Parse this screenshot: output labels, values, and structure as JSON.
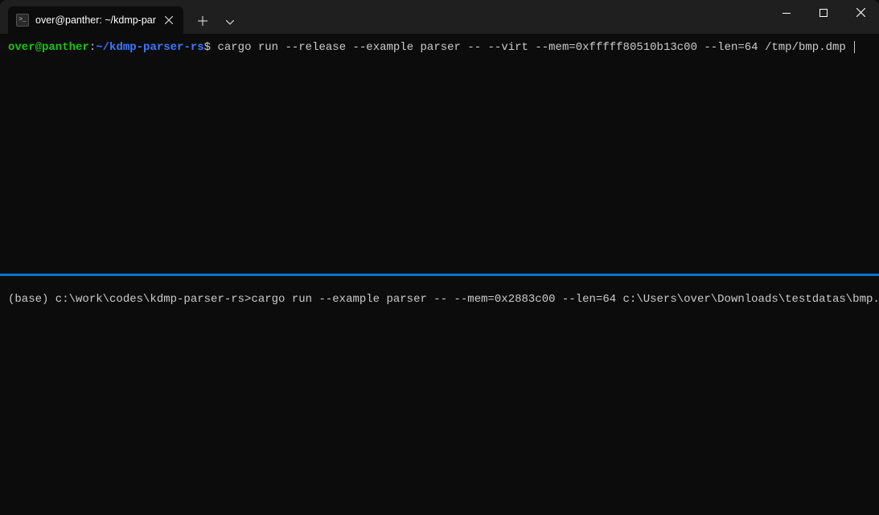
{
  "window": {
    "tab_title": "over@panther: ~/kdmp-parse"
  },
  "pane_top": {
    "prompt_user": "over@panther",
    "prompt_sep": ":",
    "prompt_path": "~/kdmp-parser-rs",
    "prompt_symbol": "$",
    "command": "cargo run --release --example parser -- --virt --mem=0xfffff80510b13c00 --len=64 /tmp/bmp.dmp"
  },
  "pane_bottom": {
    "line": "(base) c:\\work\\codes\\kdmp-parser-rs>cargo run --example parser -- --mem=0x2883c00 --len=64 c:\\Users\\over\\Downloads\\testdatas\\bmp.dmp"
  }
}
